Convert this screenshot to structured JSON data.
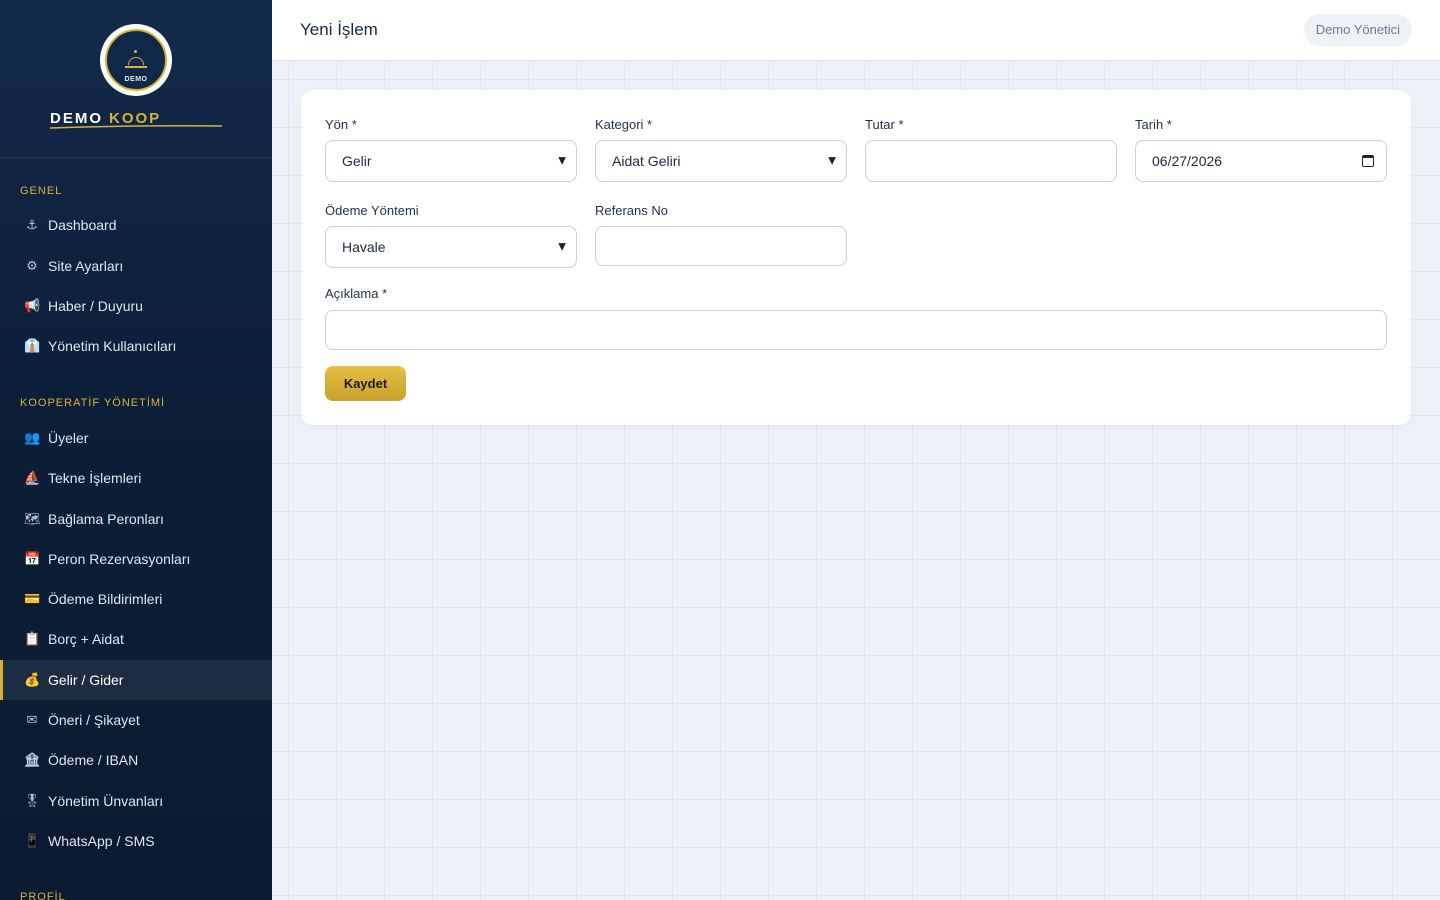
{
  "brand": {
    "logo_text": "DEMO",
    "name_part1": "DEMO",
    "name_part2": "KOOP",
    "accent_color": "#d7b23a"
  },
  "sections": {
    "genel": "GENEL",
    "kooperatif": "KOOPERATİF YÖNETİMİ",
    "profil": "PROFİL"
  },
  "nav": {
    "dashboard": {
      "icon": "⚓",
      "label": "Dashboard"
    },
    "site_ayarlari": {
      "icon": "⚙",
      "label": "Site Ayarları"
    },
    "haber": {
      "icon": "📢",
      "label": "Haber / Duyuru"
    },
    "yonetim_kullanicilari": {
      "icon": "👔",
      "label": "Yönetim Kullanıcıları"
    },
    "uyeler": {
      "icon": "👥",
      "label": "Üyeler"
    },
    "tekne": {
      "icon": "⛵",
      "label": "Tekne İşlemleri"
    },
    "baglama": {
      "icon": "🗺",
      "label": "Bağlama Peronları"
    },
    "peron_rez": {
      "icon": "📅",
      "label": "Peron Rezervasyonları"
    },
    "odeme_bildirim": {
      "icon": "💳",
      "label": "Ödeme Bildirimleri"
    },
    "borc": {
      "icon": "📋",
      "label": "Borç + Aidat"
    },
    "gelir_gider": {
      "icon": "💰",
      "label": "Gelir / Gider"
    },
    "oneri": {
      "icon": "✉",
      "label": "Öneri / Şikayet"
    },
    "odeme_iban": {
      "icon": "🏦",
      "label": "Ödeme / IBAN"
    },
    "unvanlar": {
      "icon": "🎖",
      "label": "Yönetim Ünvanları"
    },
    "whatsapp": {
      "icon": "📱",
      "label": "WhatsApp / SMS"
    }
  },
  "header": {
    "title": "Yeni İşlem",
    "user": "Demo Yönetici"
  },
  "form": {
    "yon_label": "Yön *",
    "yon_value": "Gelir",
    "kategori_label": "Kategori *",
    "kategori_value": "Aidat Geliri",
    "tutar_label": "Tutar *",
    "tutar_value": "",
    "tarih_label": "Tarih *",
    "tarih_value": "06/27/2026",
    "odeme_label": "Ödeme Yöntemi",
    "odeme_value": "Havale",
    "referans_label": "Referans No",
    "referans_value": "",
    "aciklama_label": "Açıklama *",
    "aciklama_value": "",
    "save_label": "Kaydet"
  }
}
